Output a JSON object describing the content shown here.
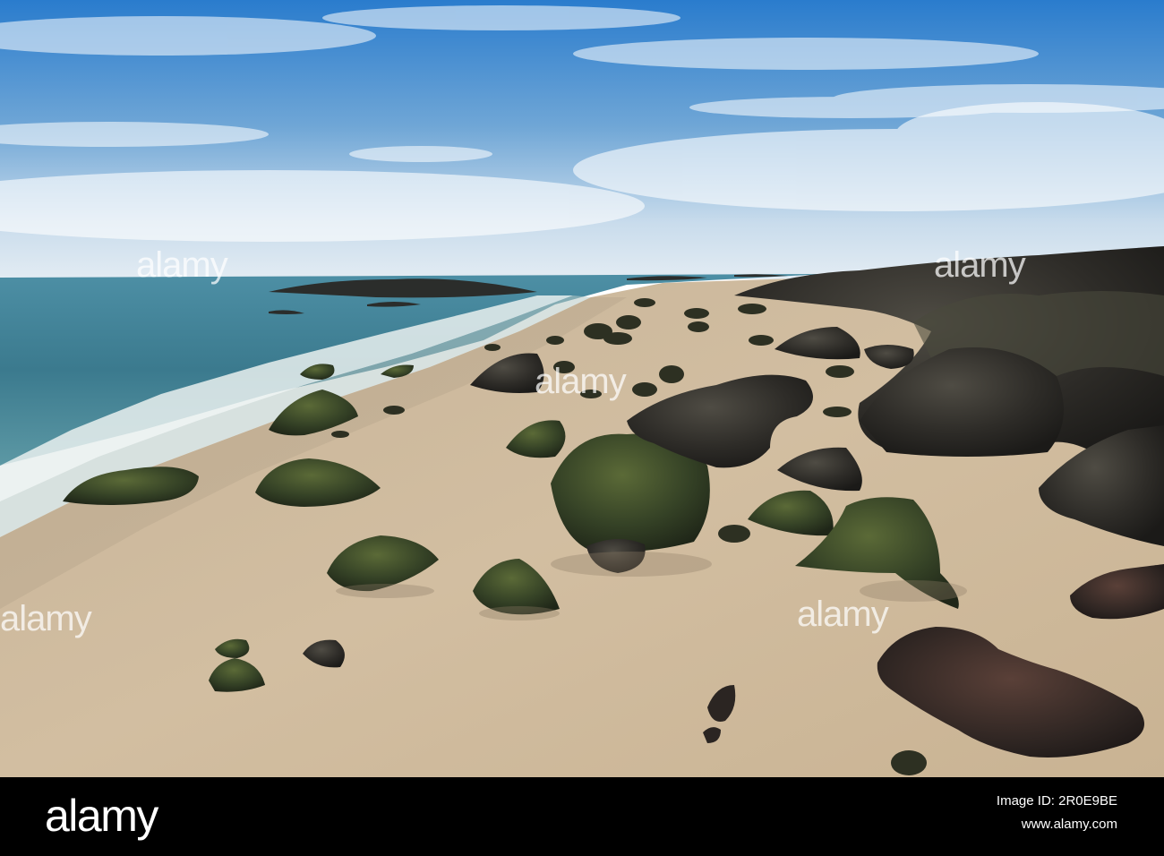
{
  "watermark": {
    "text": "alamy"
  },
  "footer": {
    "brand": "alamy",
    "image_id_label": "Image ID: 2R0E9BE",
    "url": "www.alamy.com"
  },
  "colors": {
    "sky_top": "#2b7fd0",
    "sky_horizon": "#dfe9f2",
    "sea": "#3f7d92",
    "sand": "#cdb89a",
    "rock_moss": "#3a4a2a",
    "rock_dark": "#2a2824"
  }
}
